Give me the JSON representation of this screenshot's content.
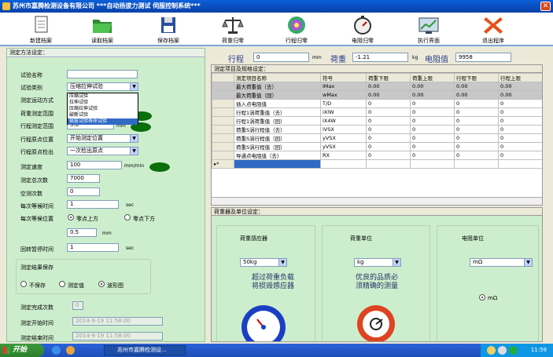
{
  "window": {
    "title": "苏州市嘉腾检测设备有限公司      ***自动扬拔力测试  伺服控制系统***"
  },
  "toolbar": [
    {
      "id": "new",
      "label": "新建档案",
      "icon": "new-file-icon"
    },
    {
      "id": "open",
      "label": "读取档案",
      "icon": "folder-icon"
    },
    {
      "id": "save",
      "label": "保存档案",
      "icon": "floppy-icon"
    },
    {
      "id": "load_zero",
      "label": "荷重归零",
      "icon": "balance-icon"
    },
    {
      "id": "travel_zero",
      "label": "行程归零",
      "icon": "target-icon"
    },
    {
      "id": "res_zero",
      "label": "电阻归零",
      "icon": "stopwatch-icon"
    },
    {
      "id": "exec",
      "label": "执行界面",
      "icon": "chart-screen-icon"
    },
    {
      "id": "exit",
      "label": "退出程序",
      "icon": "close-x-icon"
    }
  ],
  "left": {
    "header": "测定方法设定：",
    "test_name_label": "试验名称",
    "test_name_value": "",
    "test_type_label": "试验类别",
    "test_type_value": "压缩拉伸试验",
    "type_options": [
      "压缩试验",
      "拉伸试验",
      "压缩拉伸试验",
      "破断试验",
      "插拔试验寿命试验"
    ],
    "type_selected_index": 4,
    "motion_label": "测定运动方式",
    "load_range_label": "荷重测定范围",
    "travel_range_label": "行程测定范围",
    "travel_range_value": "9.8",
    "travel_range_unit": "mm",
    "origin_pos_label": "行程原点位置",
    "origin_pos_value": "开始测定位置",
    "origin_detect_label": "行程原点检出",
    "origin_detect_value": "一次检出原点",
    "speed_label": "测定速度",
    "speed_value": "100",
    "speed_unit": "mm/min",
    "total_count_label": "测定总次数",
    "total_count_value": "7000",
    "idle_count_label": "空测次数",
    "idle_count_value": "0",
    "wait_time_label": "每次等候时间",
    "wait_time_value": "1",
    "wait_time_unit": "sec",
    "wait_pos_label": "每次等候位置",
    "wait_pos_options": [
      "零点上方",
      "零点下方"
    ],
    "wait_pos_selected": 0,
    "offset_value": "0.5",
    "offset_unit": "mm",
    "return_pause_label": "回转暂停时间",
    "return_pause_value": "1",
    "return_pause_unit": "sec",
    "save_group_label": "测定结果保存",
    "save_options": [
      "不保存",
      "测定值",
      "波形图"
    ],
    "save_selected": 2,
    "done_count_label": "测定完成次数",
    "done_count_value": "0",
    "start_time_label": "测定开始时间",
    "start_time_value": "2014-9-19 11:58:00",
    "end_time_label": "测定结束时间",
    "end_time_value": "2014-9-19 11:58:00"
  },
  "readouts": {
    "travel_label": "行程",
    "travel_value": "0",
    "travel_unit": "mm",
    "load_label": "荷重",
    "load_value": "-1.21",
    "load_unit": "kg",
    "res_label": "电阻值",
    "res_value": "9958"
  },
  "spec": {
    "header": "测定项目及规格设定：",
    "columns": [
      "测定项目名称",
      "符号",
      "荷重下限",
      "荷重上限",
      "行程下限",
      "行程上限"
    ],
    "rows": [
      {
        "cells": [
          "最大荷重值（去）",
          "iMax",
          "0.00",
          "0.00",
          "0.00",
          "0.00"
        ],
        "gray": true
      },
      {
        "cells": [
          "最大荷重值（回）",
          "wMax",
          "0.00",
          "0.00",
          "0.00",
          "0.00"
        ],
        "gray": true
      },
      {
        "cells": [
          "插入点电阻值",
          "T/D",
          "0",
          "0",
          "0",
          "0"
        ],
        "gray": false
      },
      {
        "cells": [
          "行程1涡荷重值（去）",
          "iXlW",
          "0",
          "0",
          "0",
          "0"
        ],
        "gray": false
      },
      {
        "cells": [
          "行程1涡荷重值（回）",
          "iX4W",
          "0",
          "0",
          "0",
          "0"
        ],
        "gray": false
      },
      {
        "cells": [
          "荷重S涡行程值（去）",
          "iVSX",
          "0",
          "0",
          "0",
          "0"
        ],
        "gray": false
      },
      {
        "cells": [
          "荷重S涡行程值（回）",
          "yVSX",
          "0",
          "0",
          "0",
          "0"
        ],
        "gray": false
      },
      {
        "cells": [
          "荷重S涡行程值（回）",
          "yVSX",
          "0",
          "0",
          "0",
          "0"
        ],
        "gray": false
      },
      {
        "cells": [
          "导通点电阻值（去）",
          "RX",
          "0",
          "0",
          "0",
          "0"
        ],
        "gray": false
      }
    ]
  },
  "units": {
    "header": "荷重器及单位设定：",
    "sensor_title": "荷重感应器",
    "sensor_value": "50kg",
    "sensor_text": "超过荷重负载\n将损毁感应器",
    "load_unit_title": "荷重单位",
    "load_unit_value": "kg",
    "load_unit_text": "优良的品质必\n须精确的测量",
    "res_unit_title": "电阻单位",
    "res_unit_value": "mΩ",
    "res_unit_radio": "mΩ"
  },
  "taskbar": {
    "start_label": "开始",
    "task_label": "苏州市嘉腾检测设...",
    "clock": "11:59"
  }
}
